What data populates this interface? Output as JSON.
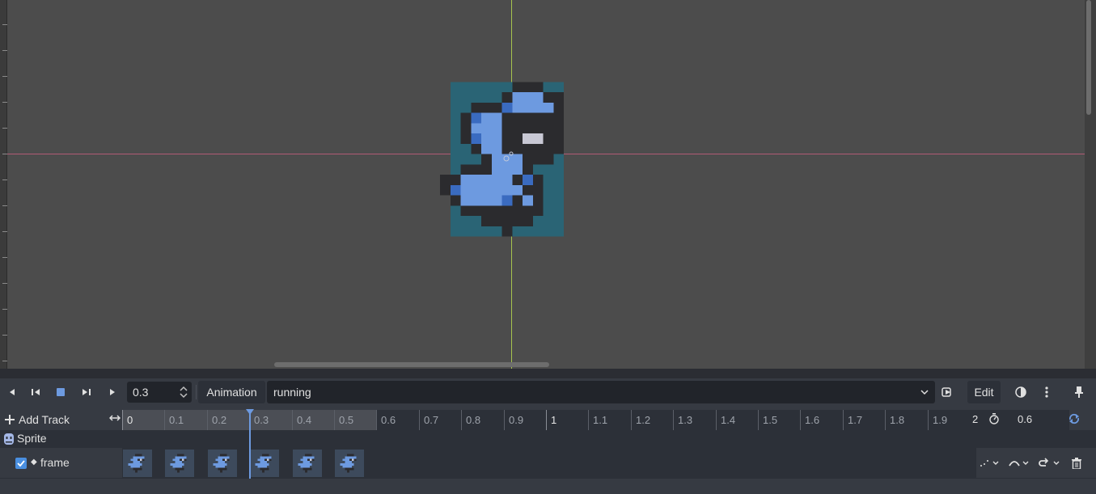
{
  "viewport": {
    "ruler_ticks": 14
  },
  "toolbar": {
    "time_value": "0.3",
    "animation_label": "Animation",
    "animation_name": "running",
    "edit_label": "Edit"
  },
  "tracks": {
    "add_track_label": "Add Track",
    "ruler_labels": [
      "0",
      "0.1",
      "0.2",
      "0.3",
      "0.4",
      "0.5",
      "0.6",
      "0.7",
      "0.8",
      "0.9",
      "1",
      "1.1",
      "1.2",
      "1.3",
      "1.4",
      "1.5",
      "1.6",
      "1.7",
      "1.8",
      "1.9",
      "2"
    ],
    "end_label": "2",
    "length_value": "0.6",
    "node_name": "Sprite",
    "track_property": "frame",
    "keyframe_count": 6,
    "track_enabled": true
  },
  "colors": {
    "accent": "#6d9ae0",
    "sprite_bg": "#2a6475",
    "sprite_blue": "#6d9ae0",
    "sprite_dark": "#2b2b2e",
    "axis_y": "#a7c34f",
    "axis_x": "#b15b75"
  }
}
